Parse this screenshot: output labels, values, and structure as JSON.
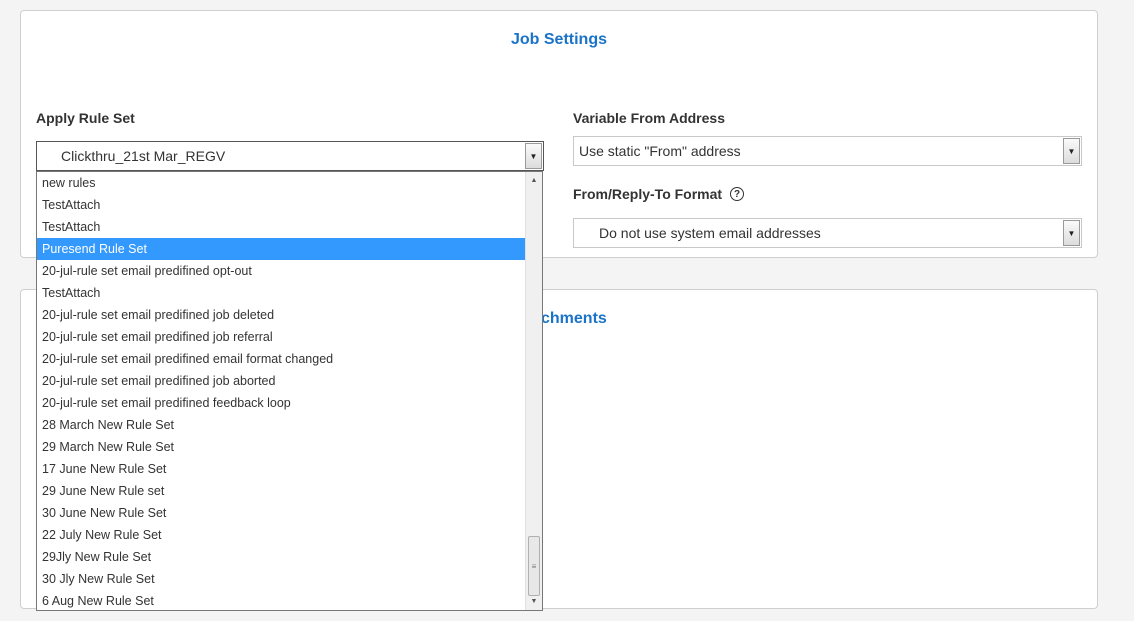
{
  "job_settings": {
    "title": "Job Settings",
    "apply_rule_set": {
      "label": "Apply Rule Set",
      "selected": "Clickthru_21st Mar_REGV",
      "options": [
        {
          "label": "new rules"
        },
        {
          "label": "TestAttach"
        },
        {
          "label": "TestAttach"
        },
        {
          "label": "Puresend Rule Set"
        },
        {
          "label": "20-jul-rule set email predifined opt-out"
        },
        {
          "label": "TestAttach"
        },
        {
          "label": "20-jul-rule set email predifined job deleted"
        },
        {
          "label": "20-jul-rule set email predifined job referral"
        },
        {
          "label": "20-jul-rule set email predifined email format changed"
        },
        {
          "label": "20-jul-rule set email predifined job aborted"
        },
        {
          "label": "20-jul-rule set email predifined feedback loop"
        },
        {
          "label": "28 March New Rule Set"
        },
        {
          "label": "29 March New Rule Set"
        },
        {
          "label": "17 June New Rule Set"
        },
        {
          "label": "29 June New Rule set"
        },
        {
          "label": "30 June New Rule Set"
        },
        {
          "label": "22 July New Rule Set"
        },
        {
          "label": "29Jly New Rule Set"
        },
        {
          "label": "30 Jly New Rule Set"
        },
        {
          "label": "6 Aug New Rule Set"
        }
      ],
      "highlighted_index": 3
    },
    "variable_from_address": {
      "label": "Variable From Address",
      "selected": "Use static \"From\" address"
    },
    "from_reply_to_format": {
      "label": "From/Reply-To Format",
      "selected": "Do not use system email addresses"
    }
  },
  "attachments": {
    "title_partial": "chments"
  },
  "icons": {
    "help": "help-circle-icon",
    "dropdown_arrow": "chevron-down-icon",
    "scroll_up": "arrow-up-icon",
    "scroll_down": "arrow-down-icon"
  },
  "colors": {
    "accent": "#1a73c8",
    "selection": "#3399ff"
  }
}
